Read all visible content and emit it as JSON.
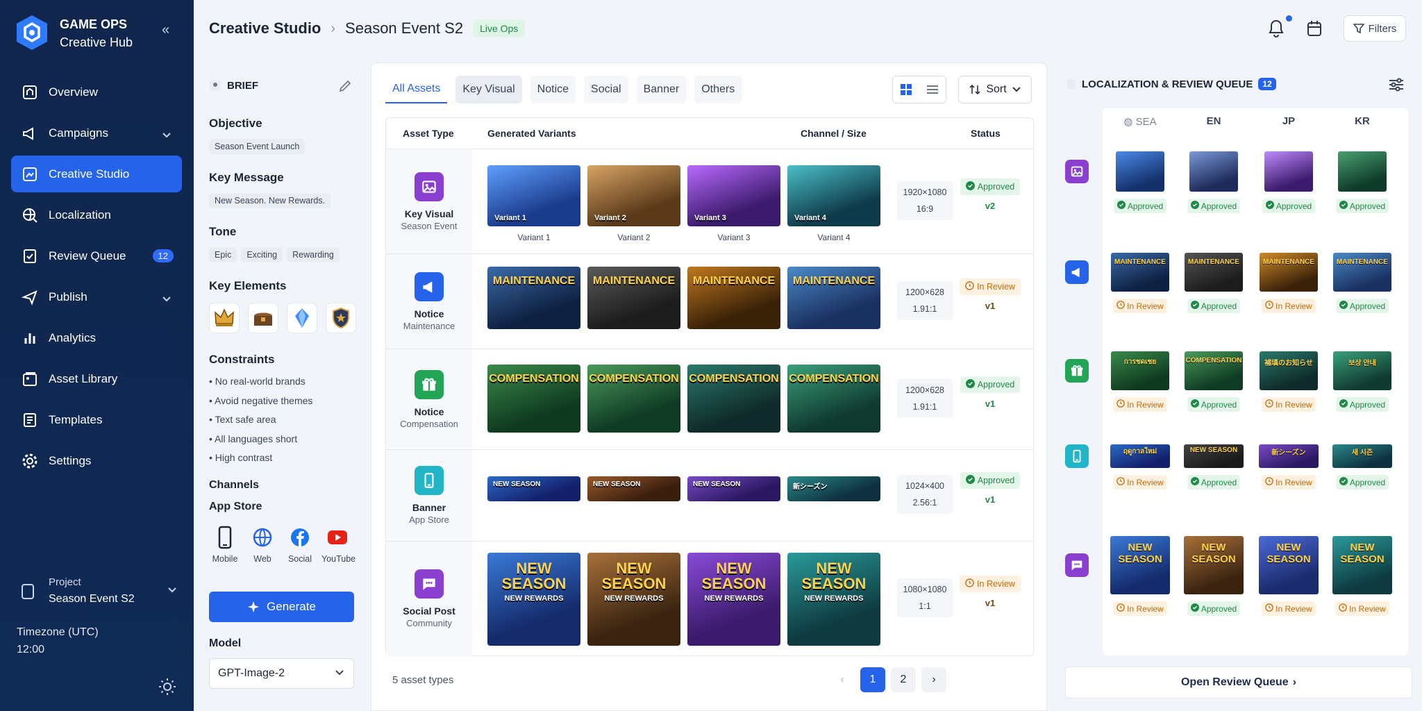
{
  "app": {
    "brand_line1": "GAME OPS",
    "brand_line2": "Creative Hub"
  },
  "nav": [
    {
      "label": "Overview",
      "icon": "overview-icon"
    },
    {
      "label": "Campaigns",
      "icon": "megaphone-icon",
      "chevron": true
    },
    {
      "label": "Creative Studio",
      "icon": "palette-icon",
      "active": true
    },
    {
      "label": "Localization",
      "icon": "globe-icon"
    },
    {
      "label": "Review Queue",
      "icon": "review-icon",
      "badge": "12"
    },
    {
      "label": "Publish",
      "icon": "send-icon",
      "chevron": true
    },
    {
      "label": "Analytics",
      "icon": "chart-icon"
    },
    {
      "label": "Asset Library",
      "icon": "library-icon"
    },
    {
      "label": "Templates",
      "icon": "template-icon"
    },
    {
      "label": "Settings",
      "icon": "gear-icon"
    }
  ],
  "project": {
    "label": "Project",
    "value": "Season Event S2"
  },
  "timezone": {
    "label": "Timezone (UTC)",
    "value": "12:00"
  },
  "header": {
    "crumb1": "Creative Studio",
    "crumb2": "Season Event S2",
    "tag": "Live Ops",
    "filters": "Filters"
  },
  "brief": {
    "title": "BRIEF",
    "objective_t": "Objective",
    "objective": "Season Event Launch",
    "message_t": "Key Message",
    "message": "New Season. New Rewards.",
    "tone_t": "Tone",
    "tones": [
      "Epic",
      "Exciting",
      "Rewarding"
    ],
    "elements_t": "Key Elements",
    "constraints_t": "Constraints",
    "constraints": [
      "No real-world brands",
      "Avoid negative themes",
      "Text safe area",
      "All languages short",
      "High contrast"
    ],
    "channels_t": "Channels",
    "store_t": "App Store",
    "channels": [
      "Mobile",
      "Web",
      "Social",
      "YouTube"
    ],
    "generate": "Generate",
    "model_t": "Model",
    "model": "GPT-Image-2"
  },
  "tabs": [
    "All Assets",
    "Key Visual",
    "Notice",
    "Social",
    "Banner",
    "Others"
  ],
  "sort": "Sort",
  "table": {
    "headers": [
      "Asset Type",
      "Generated Variants",
      "Channel / Size",
      "Status"
    ],
    "rows": [
      {
        "name": "Key Visual",
        "sub": "Season Event",
        "size": "1920×1080",
        "ratio": "16:9",
        "status": "Approved",
        "ver": "v2",
        "thumb_labels": [
          "Variant 1",
          "Variant 2",
          "Variant 3",
          "Variant 4"
        ],
        "captions": [
          "Variant 1",
          "Variant 2",
          "Variant 3",
          "Variant 4"
        ]
      },
      {
        "name": "Notice",
        "sub": "Maintenance",
        "size": "1200×628",
        "ratio": "1.91:1",
        "status": "In Review",
        "ver": "v1",
        "thumb_labels": [
          "MAINTENANCE",
          "MAINTENANCE",
          "MAINTENANCE",
          "MAINTENANCE"
        ]
      },
      {
        "name": "Notice",
        "sub": "Compensation",
        "size": "1200×628",
        "ratio": "1.91:1",
        "status": "Approved",
        "ver": "v1",
        "thumb_labels": [
          "COMPENSATION",
          "COMPENSATION",
          "COMPENSATION",
          "COMPENSATION"
        ]
      },
      {
        "name": "Banner",
        "sub": "App Store",
        "size": "1024×400",
        "ratio": "2.56:1",
        "status": "Approved",
        "ver": "v1",
        "thumb_labels": [
          "NEW SEASON",
          "NEW SEASON",
          "NEW SEASON",
          "新シーズン"
        ]
      },
      {
        "name": "Social Post",
        "sub": "Community",
        "size": "1080×1080",
        "ratio": "1:1",
        "status": "In Review",
        "ver": "v1",
        "thumb_labels": [
          "NEW SEASON",
          "NEW SEASON",
          "NEW SEASON",
          "NEW SEASON"
        ],
        "thumb_sub": "NEW REWARDS"
      }
    ]
  },
  "footer": {
    "count": "5 asset types",
    "pages": [
      "1",
      "2"
    ]
  },
  "queue": {
    "title": "LOCALIZATION & REVIEW QUEUE",
    "count": "12",
    "cols": [
      "SEA",
      "EN",
      "JP",
      "KR"
    ],
    "rows": [
      {
        "texts": [
          "",
          "",
          "",
          ""
        ],
        "status": [
          "Approved",
          "Approved",
          "Approved",
          "Approved"
        ]
      },
      {
        "texts": [
          "MAINTENANCE",
          "MAINTENANCE",
          "MAINTENANCE",
          "MAINTENANCE"
        ],
        "status": [
          "In Review",
          "Approved",
          "In Review",
          "Approved"
        ]
      },
      {
        "texts": [
          "การชดเชย",
          "COMPENSATION",
          "補填のお知らせ",
          "보상 안내"
        ],
        "status": [
          "In Review",
          "Approved",
          "In Review",
          "Approved"
        ]
      },
      {
        "texts": [
          "ฤดูกาลใหม่",
          "NEW SEASON",
          "新シーズン",
          "새 시즌"
        ],
        "status": [
          "In Review",
          "Approved",
          "In Review",
          "Approved"
        ]
      },
      {
        "texts": [
          "NEW SEASON",
          "NEW SEASON",
          "NEW SEASON",
          "NEW SEASON"
        ],
        "status": [
          "In Review",
          "Approved",
          "In Review",
          "In Review"
        ]
      }
    ],
    "open": "Open Review Queue"
  },
  "colors": {
    "accent": "#2563eb",
    "approved": "#1f8a47",
    "review": "#c36a10",
    "sidebar": "#10264d"
  }
}
